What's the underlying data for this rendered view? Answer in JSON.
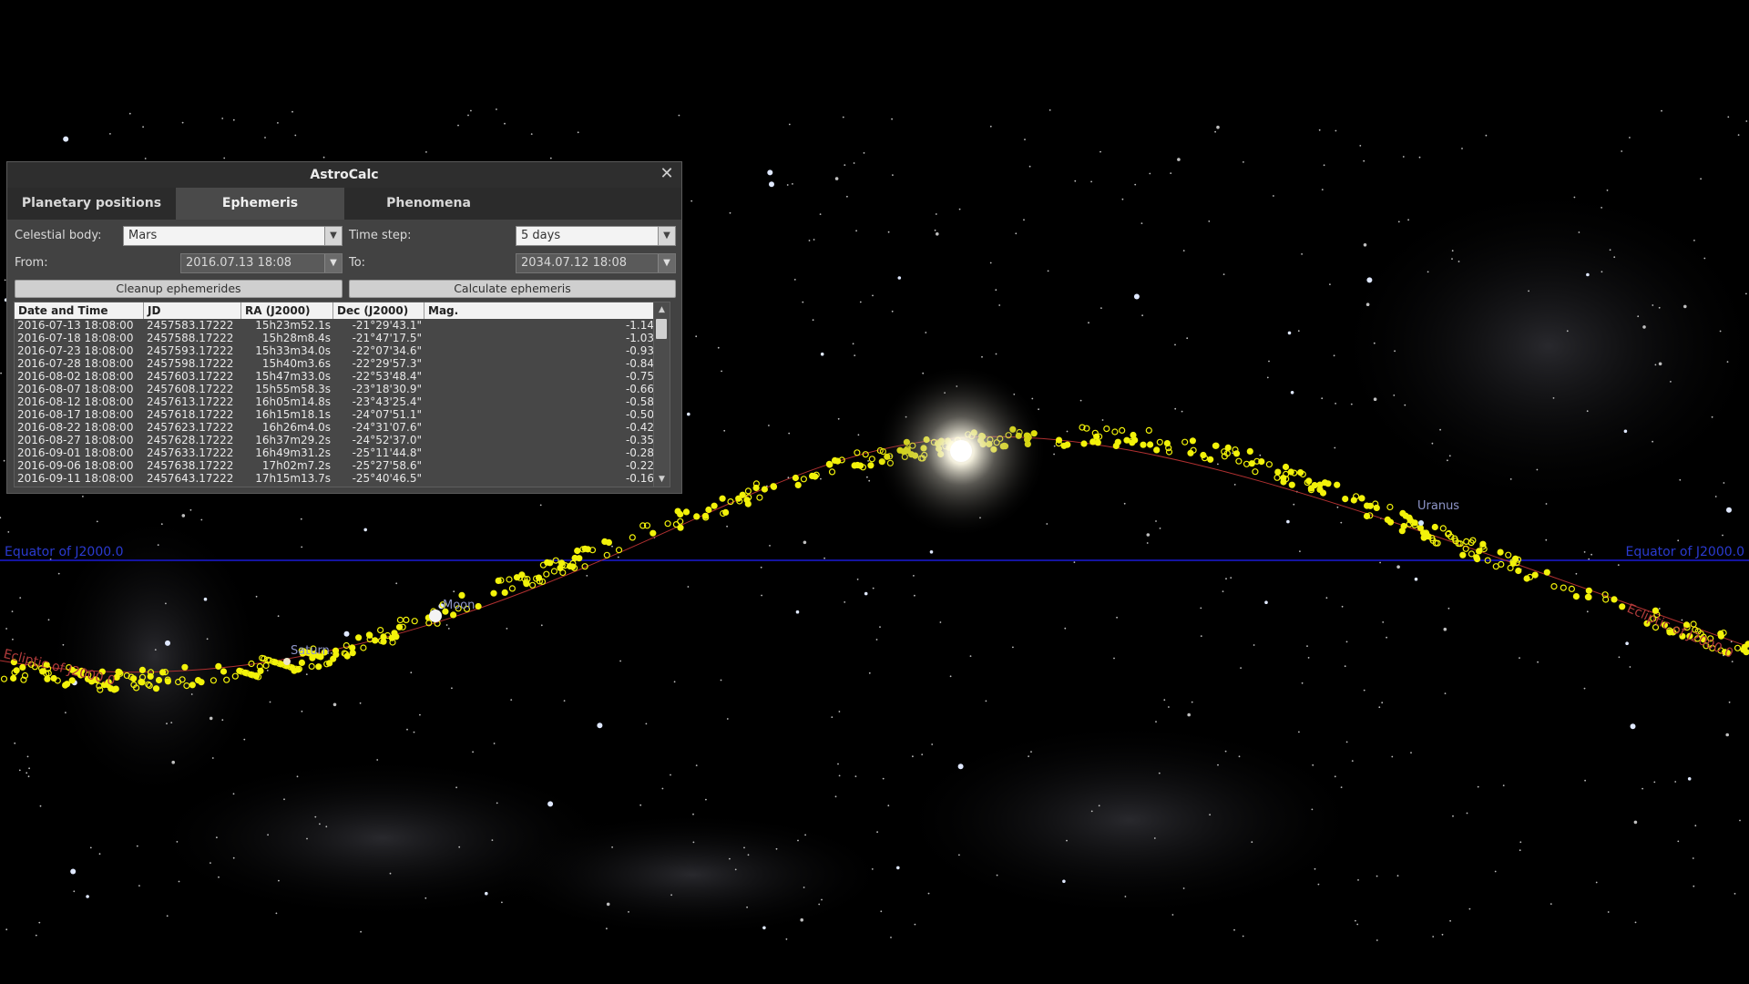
{
  "sky": {
    "labels": {
      "moon": "Moon",
      "saturn": "Saturn",
      "uranus": "Uranus",
      "equator_left": "Equator of J2000.0",
      "equator_right": "Equator of J2000.0",
      "ecliptic_left": "Ecliptic of J2000.0",
      "ecliptic_right": "Ecliptic of J2000.0"
    },
    "colors": {
      "ephemeris_markers": "#f2f20a",
      "equator_line": "#1a1ad6",
      "ecliptic_line": "#b03030",
      "planet_label": "#8e95c8"
    }
  },
  "dialog": {
    "title": "AstroCalc",
    "close_icon": "close-icon",
    "tabs": [
      {
        "label": "Planetary positions",
        "active": false
      },
      {
        "label": "Ephemeris",
        "active": true
      },
      {
        "label": "Phenomena",
        "active": false
      }
    ],
    "form": {
      "celestial_body_label": "Celestial body:",
      "celestial_body_value": "Mars",
      "time_step_label": "Time step:",
      "time_step_value": "5 days",
      "from_label": "From:",
      "from_value": "2016.07.13 18:08",
      "to_label": "To:",
      "to_value": "2034.07.12 18:08",
      "cleanup_button": "Cleanup ephemerides",
      "calculate_button": "Calculate ephemeris"
    },
    "table": {
      "columns": [
        "Date and Time",
        "JD",
        "RA (J2000)",
        "Dec (J2000)",
        "Mag."
      ],
      "rows": [
        [
          "2016-07-13 18:08:00",
          "2457583.17222",
          "15h23m52.1s",
          "-21°29'43.1\"",
          "-1.14"
        ],
        [
          "2016-07-18 18:08:00",
          "2457588.17222",
          "15h28m8.4s",
          "-21°47'17.5\"",
          "-1.03"
        ],
        [
          "2016-07-23 18:08:00",
          "2457593.17222",
          "15h33m34.0s",
          "-22°07'34.6\"",
          "-0.93"
        ],
        [
          "2016-07-28 18:08:00",
          "2457598.17222",
          "15h40m3.6s",
          "-22°29'57.3\"",
          "-0.84"
        ],
        [
          "2016-08-02 18:08:00",
          "2457603.17222",
          "15h47m33.0s",
          "-22°53'48.4\"",
          "-0.75"
        ],
        [
          "2016-08-07 18:08:00",
          "2457608.17222",
          "15h55m58.3s",
          "-23°18'30.9\"",
          "-0.66"
        ],
        [
          "2016-08-12 18:08:00",
          "2457613.17222",
          "16h05m14.8s",
          "-23°43'25.4\"",
          "-0.58"
        ],
        [
          "2016-08-17 18:08:00",
          "2457618.17222",
          "16h15m18.1s",
          "-24°07'51.1\"",
          "-0.50"
        ],
        [
          "2016-08-22 18:08:00",
          "2457623.17222",
          "16h26m4.0s",
          "-24°31'07.6\"",
          "-0.42"
        ],
        [
          "2016-08-27 18:08:00",
          "2457628.17222",
          "16h37m29.2s",
          "-24°52'37.0\"",
          "-0.35"
        ],
        [
          "2016-09-01 18:08:00",
          "2457633.17222",
          "16h49m31.2s",
          "-25°11'44.8\"",
          "-0.28"
        ],
        [
          "2016-09-06 18:08:00",
          "2457638.17222",
          "17h02m7.2s",
          "-25°27'58.6\"",
          "-0.22"
        ],
        [
          "2016-09-11 18:08:00",
          "2457643.17222",
          "17h15m13.7s",
          "-25°40'46.5\"",
          "-0.16"
        ]
      ]
    }
  }
}
